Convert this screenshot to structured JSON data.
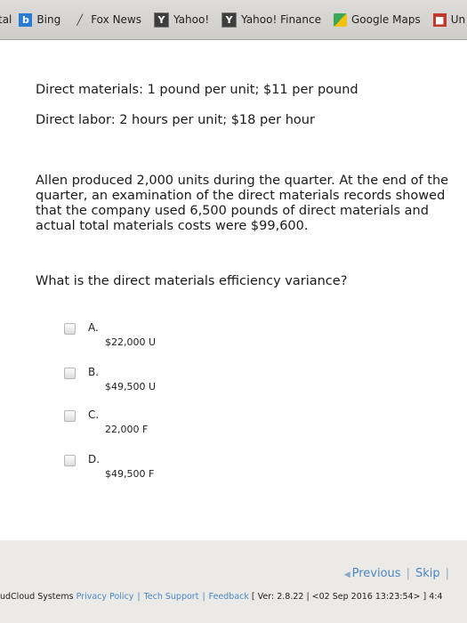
{
  "bookmarks": [
    {
      "label": "tal",
      "icon": ""
    },
    {
      "label": "Bing",
      "icon": "bing-icon"
    },
    {
      "label": "Fox News",
      "icon": "fox-news-icon"
    },
    {
      "label": "Yahoo!",
      "icon": "yahoo-icon"
    },
    {
      "label": "Yahoo! Finance",
      "icon": "yahoo-finance-icon"
    },
    {
      "label": "Google Maps",
      "icon": "google-maps-icon"
    },
    {
      "label": "Un",
      "icon": "un-icon"
    }
  ],
  "question": {
    "material_line": "Direct materials: 1 pound per unit; $11 per pound",
    "labor_line": "Direct labor: 2 hours per unit; $18 per hour",
    "scenario": "Allen produced 2,000 units during the quarter. At the end of the quarter, an examination of the direct materials records showed that the company used 6,500 pounds of direct materials and actual total materials costs were $99,600.",
    "prompt": "What is the direct materials efficiency variance?",
    "options": [
      {
        "letter": "A.",
        "text": "$22,000 U"
      },
      {
        "letter": "B.",
        "text": "$49,500 U"
      },
      {
        "letter": "C.",
        "text": "22,000 F"
      },
      {
        "letter": "D.",
        "text": "$49,500 F"
      }
    ]
  },
  "footer": {
    "previous": "Previous",
    "skip": "Skip",
    "company": "udCloud Systems",
    "privacy": "Privacy Policy",
    "tech_support": "Tech Support",
    "feedback": "Feedback",
    "version": "[ Ver: 2.8.22 ",
    "build": " <02 Sep 2016 13:23:54> ]",
    "trailing": "4:4"
  },
  "colors": {
    "link": "#4a87c9",
    "panel": "#ffffff",
    "footer": "#eceae6"
  }
}
